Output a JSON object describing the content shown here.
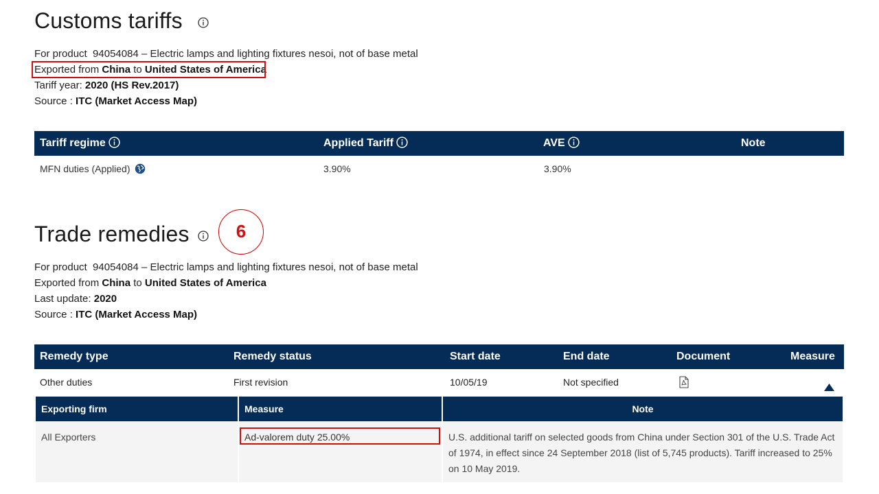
{
  "customs": {
    "title": "Customs tariffs",
    "product_prefix": "For product",
    "product_code": "94054084",
    "product_desc": "– Electric lamps and lighting fixtures nesoi, not of base metal",
    "exported_from_label": "Exported from",
    "origin": "China",
    "to_label": "to",
    "destination": "United States of America",
    "tariff_year_label": "Tariff year:",
    "tariff_year_value": "2020 (HS Rev.2017)",
    "source_label": "Source :",
    "source_value": "ITC (Market Access Map)",
    "table": {
      "headers": {
        "regime": "Tariff regime",
        "applied": "Applied Tariff",
        "ave": "AVE",
        "note": "Note"
      },
      "row": {
        "regime": "MFN duties (Applied)",
        "applied": "3.90%",
        "ave": "3.90%",
        "note": ""
      }
    }
  },
  "annotation": {
    "step": "6"
  },
  "remedies": {
    "title": "Trade remedies",
    "product_prefix": "For product",
    "product_code": "94054084",
    "product_desc": "– Electric lamps and lighting fixtures nesoi, not of base metal",
    "exported_from_label": "Exported from",
    "origin": "China",
    "to_label": "to",
    "destination": "United States of America",
    "last_update_label": "Last update:",
    "last_update_value": "2020",
    "source_label": "Source :",
    "source_value": "ITC (Market Access Map)",
    "table": {
      "headers": {
        "type": "Remedy type",
        "status": "Remedy status",
        "start": "Start date",
        "end": "End date",
        "document": "Document",
        "measure": "Measure"
      },
      "row": {
        "type": "Other duties",
        "status": "First revision",
        "start": "10/05/19",
        "end": "Not specified"
      },
      "detail": {
        "headers": {
          "firm": "Exporting firm",
          "measure": "Measure",
          "note": "Note"
        },
        "row": {
          "firm": "All Exporters",
          "measure": "Ad-valorem duty 25.00%",
          "note": "U.S. additional tariff on selected goods from China under Section 301 of the U.S. Trade Act of 1974, in effect since 24 September 2018 (list of 5,745 products). Tariff increased to 25% on 10 May 2019."
        }
      }
    }
  },
  "icons": {
    "info": "info-circle-icon",
    "globe": "globe-icon",
    "document": "pdf-document-icon",
    "collapse": "triangle-up-icon"
  },
  "colors": {
    "header_bg": "#052c56",
    "highlight": "#d01010"
  }
}
